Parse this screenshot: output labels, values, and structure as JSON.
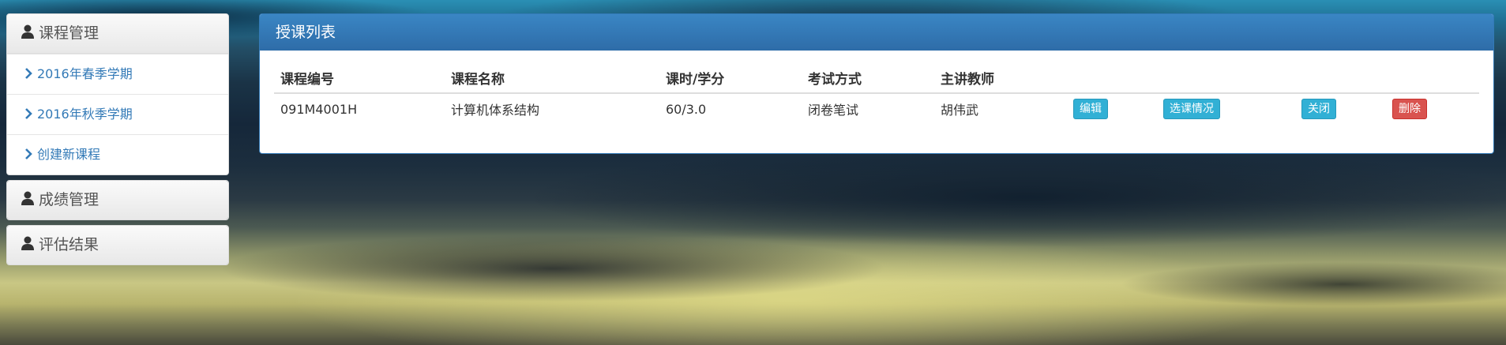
{
  "sidebar": {
    "panels": [
      {
        "title": "课程管理",
        "items": [
          {
            "label": "2016年春季学期"
          },
          {
            "label": "2016年秋季学期"
          },
          {
            "label": "创建新课程"
          }
        ]
      },
      {
        "title": "成绩管理"
      },
      {
        "title": "评估结果"
      }
    ]
  },
  "main": {
    "title": "授课列表",
    "table": {
      "headers": [
        "课程编号",
        "课程名称",
        "课时/学分",
        "考试方式",
        "主讲教师"
      ],
      "rows": [
        {
          "code": "091M4001H",
          "name": "计算机体系结构",
          "hours_credits": "60/3.0",
          "exam": "闭卷笔试",
          "teacher": "胡伟武",
          "actions": {
            "edit": "编辑",
            "enrollment": "选课情况",
            "close": "关闭",
            "delete": "删除"
          }
        }
      ]
    }
  },
  "colors": {
    "primary": "#337ab7",
    "info_button": "#31b0d5",
    "danger_button": "#d9534f"
  },
  "icons": {
    "panel_heading": "user-icon",
    "nav_item": "chevron-right-icon"
  }
}
